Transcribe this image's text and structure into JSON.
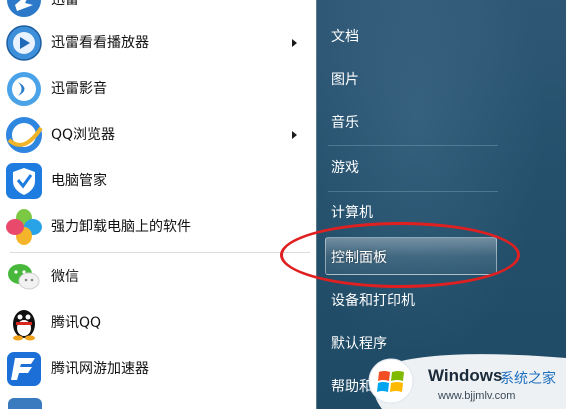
{
  "left_menu": {
    "items": [
      {
        "label": "迅雷",
        "icon": "xunlei-icon",
        "arrow": false
      },
      {
        "label": "迅雷看看播放器",
        "icon": "xunlei-kankan-icon",
        "arrow": true
      },
      {
        "label": "迅雷影音",
        "icon": "xunlei-yingyin-icon",
        "arrow": false
      },
      {
        "label": "QQ浏览器",
        "icon": "qq-browser-icon",
        "arrow": true
      },
      {
        "label": "电脑管家",
        "icon": "pc-manager-shield-icon",
        "arrow": false
      },
      {
        "label": "强力卸载电脑上的软件",
        "icon": "uninstaller-petal-icon",
        "arrow": false
      },
      {
        "label": "微信",
        "icon": "wechat-icon",
        "arrow": false
      },
      {
        "label": "腾讯QQ",
        "icon": "qq-penguin-icon",
        "arrow": false
      },
      {
        "label": "腾讯网游加速器",
        "icon": "game-accelerator-icon",
        "arrow": false
      }
    ]
  },
  "right_menu": {
    "items": [
      {
        "label": "文档"
      },
      {
        "label": "图片"
      },
      {
        "label": "音乐"
      },
      {
        "label": "游戏"
      },
      {
        "label": "计算机"
      },
      {
        "label": "控制面板"
      },
      {
        "label": "设备和打印机"
      },
      {
        "label": "默认程序"
      },
      {
        "label": "帮助和支持"
      }
    ],
    "highlighted": "控制面板"
  },
  "watermark": {
    "brand": "Windows",
    "site_name": "系统之家",
    "url": "www.bjjmlv.com"
  },
  "colors": {
    "right_panel": "#24506c",
    "annotation": "#e02020"
  }
}
